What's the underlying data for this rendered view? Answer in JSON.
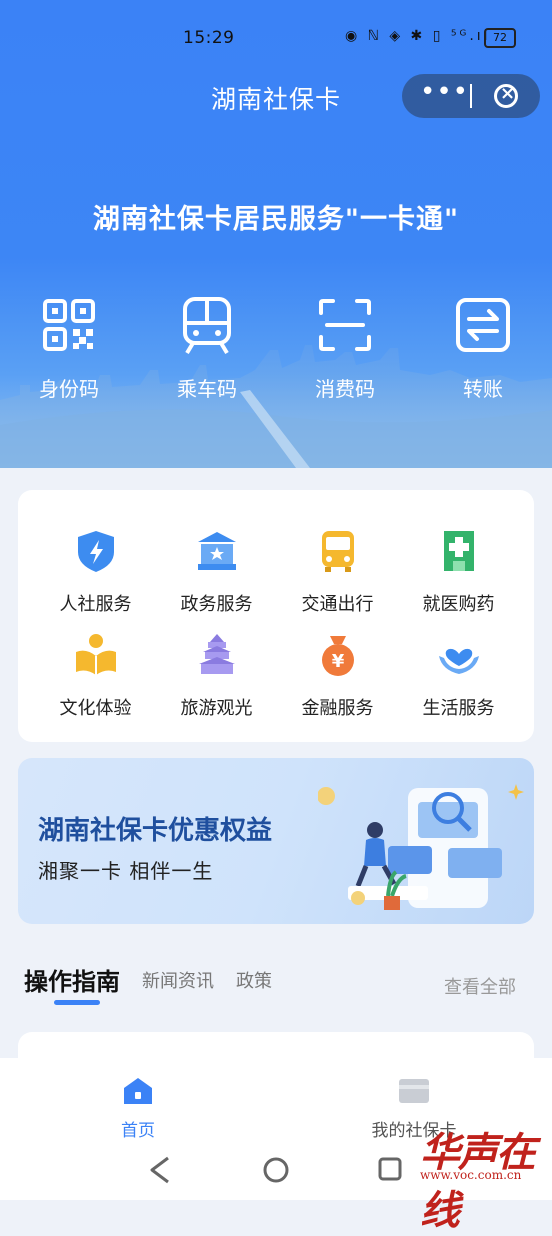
{
  "status_bar": {
    "time": "15:29",
    "icons_text": "◉ ℕ ◈ ✱ ▯ ⁵ᴳ.ıl",
    "battery": "72"
  },
  "app": {
    "title": "湖南社保卡",
    "more": "•••"
  },
  "hero": {
    "title": "湖南社保卡居民服务\"一卡通\""
  },
  "quick_actions": [
    {
      "label": "身份码",
      "icon": "qr-code-icon"
    },
    {
      "label": "乘车码",
      "icon": "train-icon"
    },
    {
      "label": "消费码",
      "icon": "scan-icon"
    },
    {
      "label": "转账",
      "icon": "transfer-icon"
    }
  ],
  "services": [
    {
      "label": "人社服务",
      "icon": "shield-bolt-icon",
      "color": "#3d8cf0"
    },
    {
      "label": "政务服务",
      "icon": "government-building-icon",
      "color": "#3d8cf0"
    },
    {
      "label": "交通出行",
      "icon": "bus-icon",
      "color": "#f5b82e"
    },
    {
      "label": "就医购药",
      "icon": "hospital-icon",
      "color": "#33b36b"
    },
    {
      "label": "文化体验",
      "icon": "reading-icon",
      "color": "#f5b82e"
    },
    {
      "label": "旅游观光",
      "icon": "temple-icon",
      "color": "#8a7be0"
    },
    {
      "label": "金融服务",
      "icon": "money-bag-icon",
      "color": "#f07a3a"
    },
    {
      "label": "生活服务",
      "icon": "heart-hands-icon",
      "color": "#3d8cf0"
    }
  ],
  "banner": {
    "title": "湖南社保卡优惠权益",
    "subtitle": "湘聚一卡  相伴一生"
  },
  "tabs": {
    "active": "操作指南",
    "items": [
      "新闻资讯",
      "政策"
    ],
    "see_all": "查看全部"
  },
  "bottom_nav": [
    {
      "label": "首页",
      "icon": "home-icon",
      "active": true
    },
    {
      "label": "我的社保卡",
      "icon": "card-icon",
      "active": false
    }
  ],
  "watermark": {
    "text": "华声在线",
    "url": "www.voc.com.cn"
  },
  "colors": {
    "primary": "#3b82f6",
    "banner_title": "#1f4f9e"
  }
}
